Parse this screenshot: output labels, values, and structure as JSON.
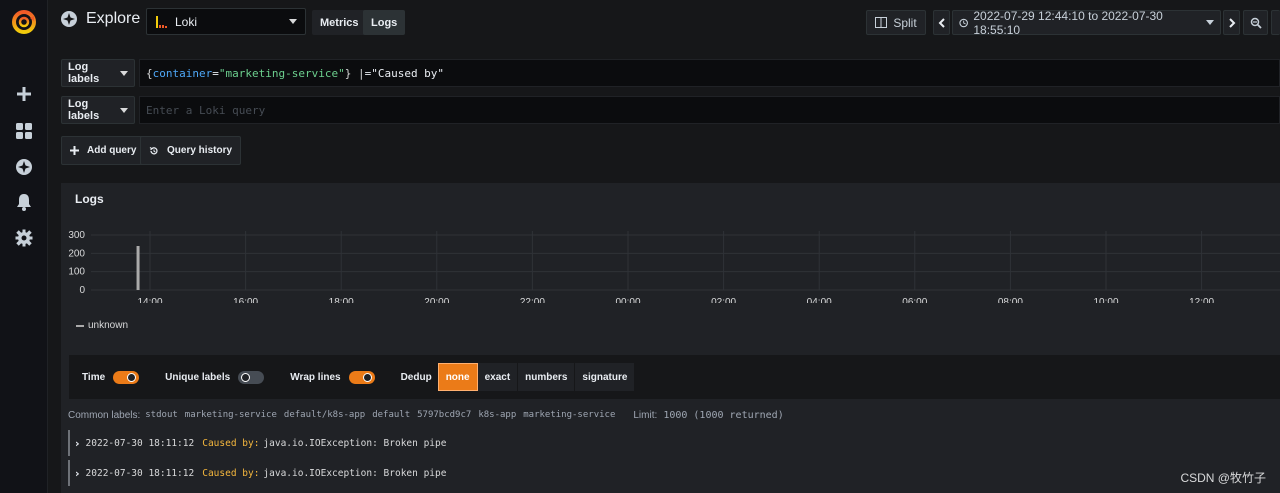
{
  "sidebar": {
    "logo": "grafana-logo",
    "items": [
      {
        "icon": "plus-icon"
      },
      {
        "icon": "dashboards-icon"
      },
      {
        "icon": "explore-compass-icon"
      },
      {
        "icon": "bell-icon"
      },
      {
        "icon": "gear-icon"
      }
    ]
  },
  "navbar": {
    "title": "Explore",
    "datasource": "Loki",
    "modes": [
      "Metrics",
      "Logs"
    ],
    "active_mode": "Logs",
    "split_label": "Split",
    "time_range": "2022-07-29 12:44:10 to 2022-07-30 18:55:10"
  },
  "queries": [
    {
      "label_button": "Log labels",
      "tokens": {
        "open": "{",
        "key": "container",
        "eq": "=",
        "value": "\"marketing-service\"",
        "close": "}",
        "pipe": " |",
        "op": "=",
        "filter": "\"Caused by\""
      }
    },
    {
      "label_button": "Log labels",
      "placeholder": "Enter a Loki query"
    }
  ],
  "actions": {
    "add_query": "Add query",
    "query_history": "Query history"
  },
  "logs_panel": {
    "title": "Logs",
    "legend": "unknown"
  },
  "chart_data": {
    "type": "bar",
    "yticks": [
      "300",
      "200",
      "100",
      "0"
    ],
    "ylim": [
      0,
      300
    ],
    "xticks": [
      "14:00",
      "16:00",
      "18:00",
      "20:00",
      "22:00",
      "00:00",
      "02:00",
      "04:00",
      "06:00",
      "08:00",
      "10:00",
      "12:00"
    ],
    "series": [
      {
        "name": "unknown",
        "points": [
          {
            "x": "13:45",
            "y": 240
          }
        ]
      }
    ],
    "grid": true
  },
  "options": {
    "time": "Time",
    "time_on": true,
    "unique_labels": "Unique labels",
    "unique_on": false,
    "wrap_lines": "Wrap lines",
    "wrap_on": true,
    "dedup": "Dedup",
    "dedup_options": [
      "none",
      "exact",
      "numbers",
      "signature"
    ],
    "dedup_selected": "none"
  },
  "common_labels": {
    "title": "Common labels:",
    "chips": [
      "stdout",
      "marketing-service",
      "default/k8s-app",
      "default",
      "5797bcd9c7",
      "k8s-app",
      "marketing-service"
    ],
    "limit_label": "Limit:",
    "limit_value": "1000 (1000 returned)"
  },
  "log_rows": [
    {
      "timestamp": "2022-07-30 18:11:12",
      "highlight": "Caused by:",
      "message": "java.io.IOException: Broken pipe"
    },
    {
      "timestamp": "2022-07-30 18:11:12",
      "highlight": "Caused by:",
      "message": "java.io.IOException: Broken pipe"
    }
  ],
  "watermark": "CSDN @牧竹子",
  "colors": {
    "accent": "#eb7b18",
    "highlight": "#f5b73d",
    "query_key": "#4ea7f7",
    "query_value": "#6ccf8e"
  }
}
